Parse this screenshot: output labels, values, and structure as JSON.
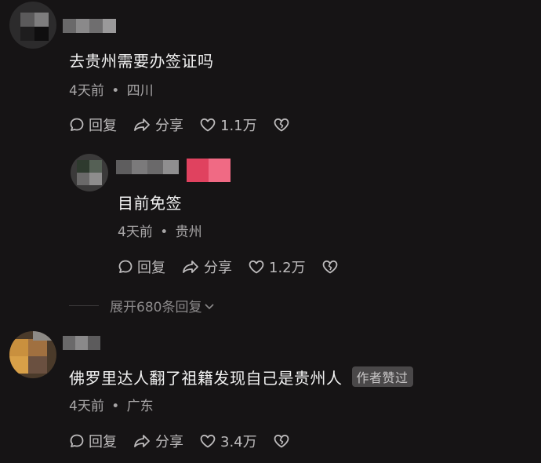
{
  "comments": [
    {
      "text": "去贵州需要办签证吗",
      "time": "4天前",
      "location": "四川",
      "reply_label": "回复",
      "share_label": "分享",
      "likes": "1.1万"
    },
    {
      "text": "目前免签",
      "time": "4天前",
      "location": "贵州",
      "reply_label": "回复",
      "share_label": "分享",
      "likes": "1.2万"
    },
    {
      "text": "佛罗里达人翻了祖籍发现自己是贵州人",
      "badge": "作者赞过",
      "time": "4天前",
      "location": "广东",
      "reply_label": "回复",
      "share_label": "分享",
      "likes": "3.4万"
    }
  ],
  "expand_replies": "展开680条回复",
  "separator": "•",
  "icons": [
    "chat-bubble-icon",
    "share-arrow-icon",
    "heart-icon",
    "broken-heart-icon",
    "chevron-down-icon"
  ]
}
